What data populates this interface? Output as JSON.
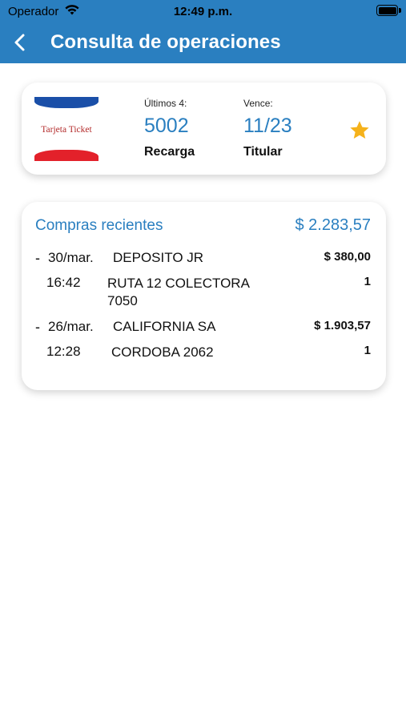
{
  "status_bar": {
    "carrier": "Operador",
    "time": "12:49 p.m."
  },
  "header": {
    "title": "Consulta de operaciones",
    "color": "#2a7fc0"
  },
  "card": {
    "brand_label": "Tarjeta Ticket",
    "last4_label": "Últimos 4:",
    "last4": "5002",
    "type": "Recarga",
    "expires_label": "Vence:",
    "expires": "11/23",
    "holder": "Titular",
    "favorite_icon": "star-icon"
  },
  "recent": {
    "title": "Compras recientes",
    "total": "$ 2.283,57",
    "items": [
      {
        "dash": "-",
        "date": "30/mar.",
        "merchant": "DEPOSITO JR",
        "amount": "$ 380,00",
        "time": "16:42",
        "address": "RUTA 12 COLECTORA 7050",
        "qty": "1"
      },
      {
        "dash": "-",
        "date": "26/mar.",
        "merchant": "CALIFORNIA SA",
        "amount": "$ 1.903,57",
        "time": "12:28",
        "address": "CORDOBA 2062",
        "qty": "1"
      }
    ]
  }
}
